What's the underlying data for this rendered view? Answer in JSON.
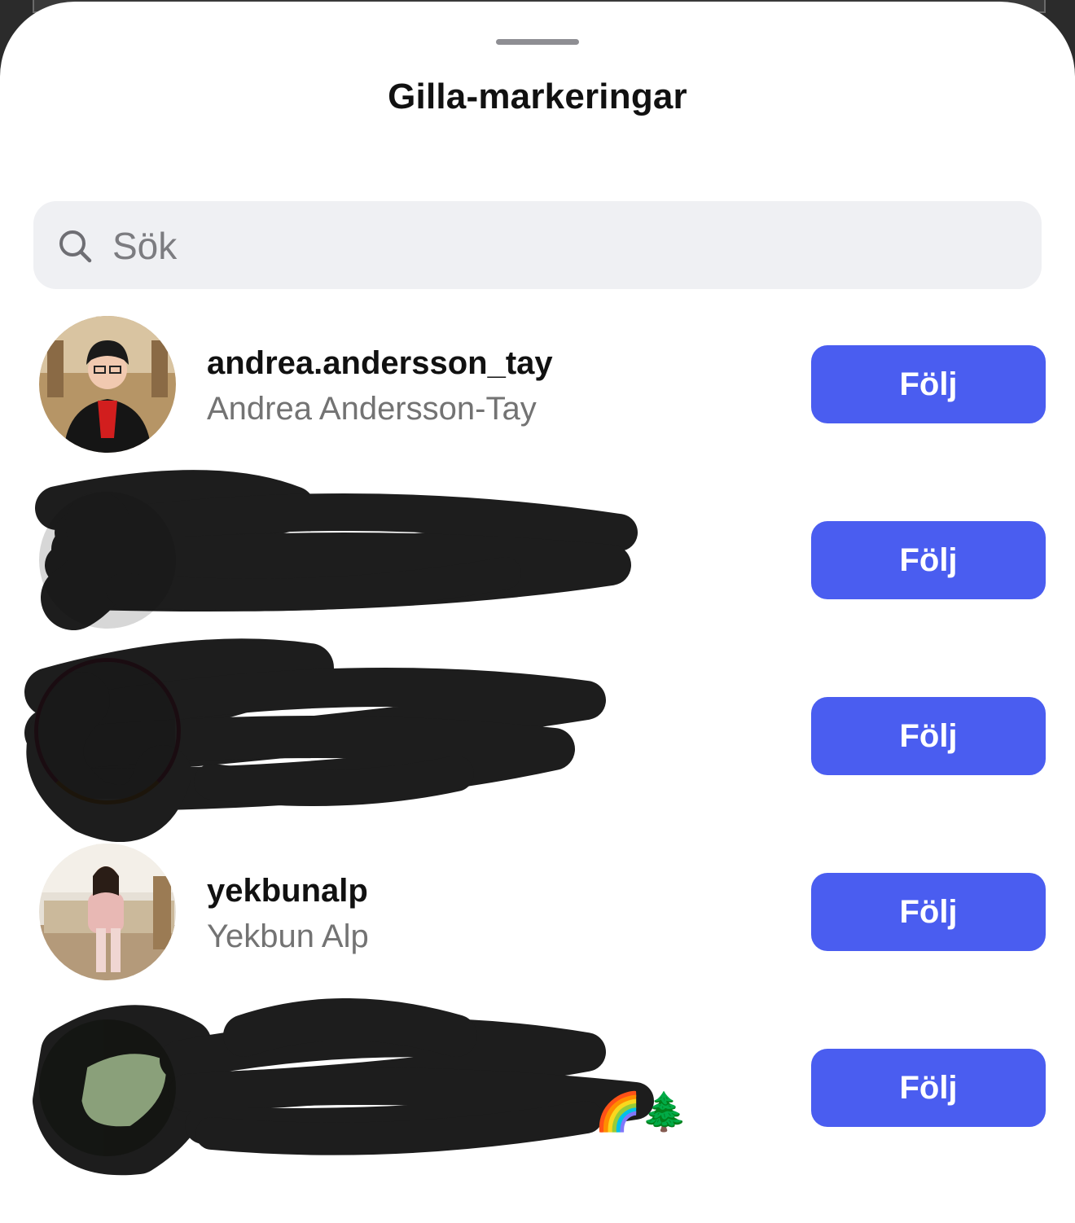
{
  "sheet": {
    "title": "Gilla-markeringar"
  },
  "search": {
    "placeholder": "Sök",
    "icon": "search-icon"
  },
  "users": [
    {
      "username": "andrea.andersson_tay",
      "full_name": "Andrea Andersson-Tay",
      "button": "Följ",
      "redacted": false
    },
    {
      "username": "",
      "full_name": "",
      "button": "Följ",
      "redacted": true
    },
    {
      "username": "",
      "full_name": "",
      "button": "Följ",
      "redacted": true
    },
    {
      "username": "yekbunalp",
      "full_name": "Yekbun Alp",
      "button": "Följ",
      "redacted": false
    },
    {
      "username": "",
      "full_name": "",
      "button": "Följ",
      "redacted": true,
      "emojis": "🌈🌲"
    }
  ],
  "colors": {
    "follow_button": "#4a5df0",
    "secondary_text": "#737373",
    "search_background": "#eff0f3"
  }
}
